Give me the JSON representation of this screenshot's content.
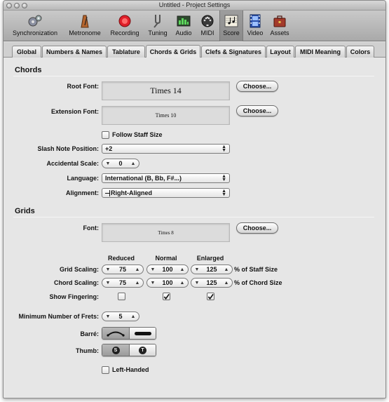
{
  "window": {
    "title": "Untitled - Project Settings"
  },
  "toolbar": {
    "items": [
      {
        "label": "Synchronization",
        "icon": "gears-icon"
      },
      {
        "label": "Metronome",
        "icon": "metronome-icon"
      },
      {
        "label": "Recording",
        "icon": "record-icon"
      },
      {
        "label": "Tuning",
        "icon": "tuning-fork-icon"
      },
      {
        "label": "Audio",
        "icon": "audio-meter-icon"
      },
      {
        "label": "MIDI",
        "icon": "midi-port-icon"
      },
      {
        "label": "Score",
        "icon": "score-notes-icon",
        "active": true
      },
      {
        "label": "Video",
        "icon": "film-strip-icon"
      },
      {
        "label": "Assets",
        "icon": "briefcase-icon"
      }
    ]
  },
  "tabs": [
    {
      "label": "Global"
    },
    {
      "label": "Numbers & Names"
    },
    {
      "label": "Tablature"
    },
    {
      "label": "Chords & Grids",
      "active": true
    },
    {
      "label": "Clefs & Signatures"
    },
    {
      "label": "Layout"
    },
    {
      "label": "MIDI Meaning"
    },
    {
      "label": "Colors"
    }
  ],
  "chords": {
    "section_title": "Chords",
    "root_font_label": "Root Font:",
    "root_font_value": "Times 14",
    "extension_font_label": "Extension Font:",
    "extension_font_value": "Times 10",
    "choose_label": "Choose...",
    "follow_staff_size_label": "Follow Staff Size",
    "follow_staff_size_checked": false,
    "slash_note_position_label": "Slash Note Position:",
    "slash_note_position_value": "+2",
    "accidental_scale_label": "Accidental Scale:",
    "accidental_scale_value": "0",
    "language_label": "Language:",
    "language_value": "International (B, Bb, F#...)",
    "alignment_label": "Alignment:",
    "alignment_value": "Right-Aligned"
  },
  "grids": {
    "section_title": "Grids",
    "font_label": "Font:",
    "font_value": "Times 8",
    "choose_label": "Choose...",
    "columns": {
      "reduced": "Reduced",
      "normal": "Normal",
      "enlarged": "Enlarged"
    },
    "grid_scaling_label": "Grid Scaling:",
    "grid_scaling": {
      "reduced": "75",
      "normal": "100",
      "enlarged": "125"
    },
    "grid_scaling_suffix": "% of Staff Size",
    "chord_scaling_label": "Chord Scaling:",
    "chord_scaling": {
      "reduced": "75",
      "normal": "100",
      "enlarged": "125"
    },
    "chord_scaling_suffix": "% of Chord Size",
    "show_fingering_label": "Show Fingering:",
    "show_fingering": {
      "reduced": false,
      "normal": true,
      "enlarged": true
    },
    "min_frets_label": "Minimum Number of Frets:",
    "min_frets_value": "5",
    "barre_label": "Barré:",
    "barre_options": [
      "arc-barre-icon",
      "bar-barre-icon"
    ],
    "barre_selected": 0,
    "thumb_label": "Thumb:",
    "thumb_options": [
      {
        "letter": "S"
      },
      {
        "letter": "T"
      }
    ],
    "thumb_selected": 0,
    "left_handed_label": "Left-Handed",
    "left_handed_checked": false
  },
  "colors": {
    "record_red": "#e0202a",
    "accent_blue": "#3b6fd8"
  }
}
